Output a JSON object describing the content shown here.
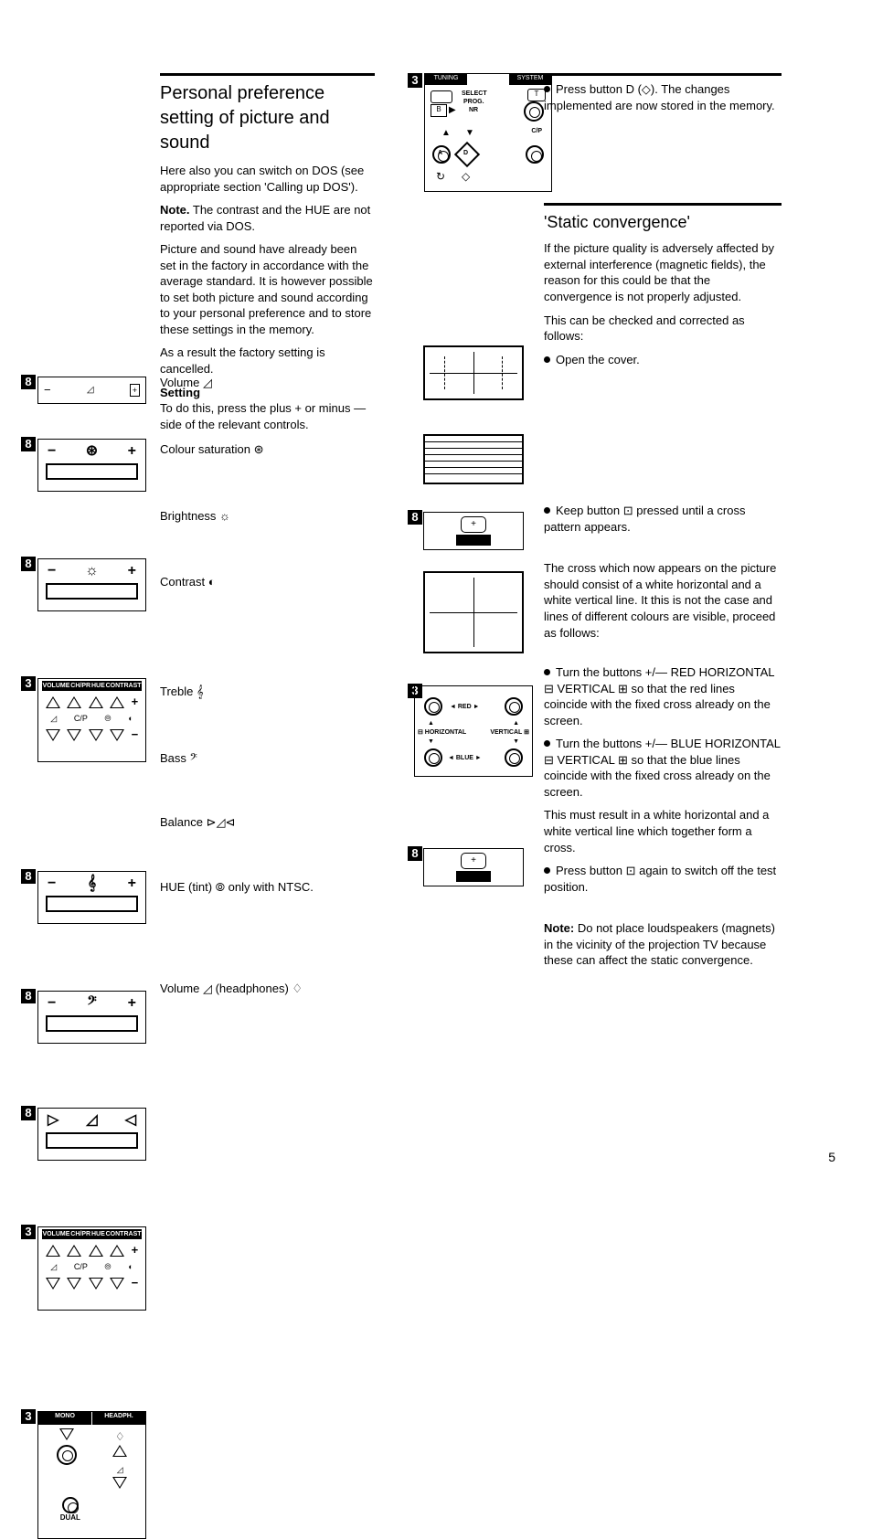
{
  "page_number": "5",
  "heading1": "Personal preference setting of picture and sound",
  "p1": "Here also you can switch on DOS (see appropriate section 'Calling up DOS').",
  "p2_label": "Note.",
  "p2": "The contrast and the HUE are not reported via DOS.",
  "p3": "Picture and sound have already been set in the factory in accordance with the average standard. It is however possible to set both picture and sound according to your personal preference and to store these settings in the memory.",
  "p3b": "As a result the factory setting is cancelled.",
  "p4_label": "Setting",
  "p4": "To do this, press the plus + or minus — side of the relevant controls.",
  "ctrl_volume": "Volume ◿",
  "ctrl_colour": "Colour saturation ⊛",
  "ctrl_brightness": "Brightness ☼",
  "ctrl_contrast": "Contrast ◐",
  "ctrl_treble": "Treble 𝄞",
  "ctrl_bass": "Bass 𝄢",
  "ctrl_balance": "Balance ⊳◿⊲",
  "ctrl_hue": "HUE (tint) ⦾ only with NTSC.",
  "ctrl_headphones": "Volume ◿ (headphones) ♢",
  "multibox_header_cols": [
    "VOLUME",
    "CH/PR",
    "HUE",
    "CONTRAST"
  ],
  "multibox_icon_cols": [
    "◿",
    "C/P",
    "⦾",
    "◐"
  ],
  "monohead_labels": {
    "mono": "MONO",
    "head": "HEADPH.",
    "dual": "DUAL"
  },
  "vol_panel": {
    "minus": "−",
    "plus": "+",
    "bal_l": "▷",
    "bal_r": "◁"
  },
  "remote": {
    "tuning": "TUNING",
    "system": "SYSTEM",
    "select": "SELECT",
    "prog": "PROG.",
    "nr": "NR",
    "cp": "C/P",
    "btn_a": "A",
    "btn_b": "B",
    "btn_d": "D",
    "btn_t": "T",
    "remote_outline": "◇"
  },
  "r1": "Press button D (◇). The changes implemented are now stored in the memory.",
  "heading2": "'Static convergence'",
  "s1": "If the picture quality is adversely affected by external interference (magnetic fields), the reason for this could be that the convergence is not properly adjusted.",
  "s1b": "This can be checked and corrected as follows:",
  "s2": "Open the cover.",
  "s3": "Keep button ⊡ pressed until a cross pattern appears.",
  "s4": "The cross which now appears on the picture should consist of a white horizontal and a white vertical line. It this is not the case and lines of different colours are visible, proceed as follows:",
  "s5": "Turn the buttons +/— RED HORIZONTAL ⊟ VERTICAL ⊞ so that the red lines coincide with the fixed cross already on the screen.",
  "s6a": "Turn the buttons +/— BLUE HORIZONTAL ⊟ VERTICAL ⊞ so that the blue lines coincide with the fixed cross already on the screen.",
  "s6b": "This must result in a white horizontal and a white vertical line which together form a cross.",
  "s7": "Press button ⊡ again to switch off the test position.",
  "s8_label": "Note:",
  "s8": "Do not place loudspeakers (magnets) in the vicinity of the projection TV because these can affect the static convergence.",
  "adjbox": {
    "red": "◄ RED ►",
    "blue": "◄ BLUE ►",
    "horiz": "⊟ HORIZONTAL",
    "vert": "VERTICAL ⊞"
  },
  "crossbtn": "+",
  "tags": {
    "t3": "3",
    "t8": "8"
  }
}
